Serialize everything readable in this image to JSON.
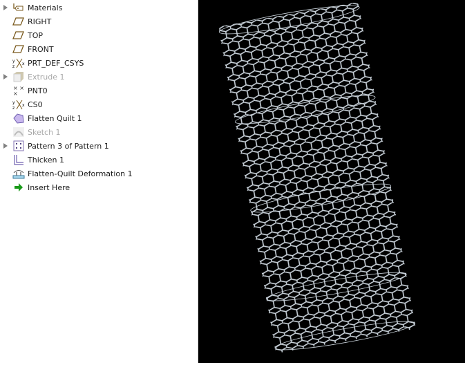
{
  "model_tree": {
    "items": [
      {
        "label": "Materials",
        "icon": "materials-icon",
        "expandable": true,
        "suppressed": false
      },
      {
        "label": "RIGHT",
        "icon": "datum-plane-icon",
        "expandable": false,
        "suppressed": false
      },
      {
        "label": "TOP",
        "icon": "datum-plane-icon",
        "expandable": false,
        "suppressed": false
      },
      {
        "label": "FRONT",
        "icon": "datum-plane-icon",
        "expandable": false,
        "suppressed": false
      },
      {
        "label": "PRT_DEF_CSYS",
        "icon": "csys-icon",
        "expandable": false,
        "suppressed": false
      },
      {
        "label": "Extrude 1",
        "icon": "extrude-icon",
        "expandable": true,
        "suppressed": true
      },
      {
        "label": "PNT0",
        "icon": "datum-point-icon",
        "expandable": false,
        "suppressed": false
      },
      {
        "label": "CS0",
        "icon": "csys-icon",
        "expandable": false,
        "suppressed": false
      },
      {
        "label": "Flatten Quilt 1",
        "icon": "flatten-quilt-icon",
        "expandable": false,
        "suppressed": false
      },
      {
        "label": "Sketch 1",
        "icon": "sketch-icon",
        "expandable": false,
        "suppressed": true
      },
      {
        "label": "Pattern 3 of Pattern 1",
        "icon": "pattern-icon",
        "expandable": true,
        "suppressed": false
      },
      {
        "label": "Thicken 1",
        "icon": "thicken-icon",
        "expandable": false,
        "suppressed": false
      },
      {
        "label": "Flatten-Quilt Deformation 1",
        "icon": "deformation-icon",
        "expandable": false,
        "suppressed": false
      },
      {
        "label": "Insert Here",
        "icon": "insert-arrow-icon",
        "expandable": false,
        "suppressed": false
      }
    ]
  },
  "viewport": {
    "background": "#000000",
    "mesh_color": "#c9d2da"
  }
}
